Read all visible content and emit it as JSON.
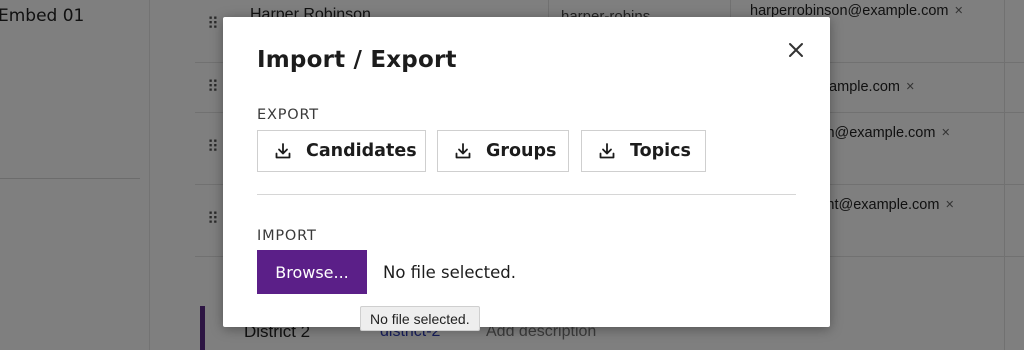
{
  "background": {
    "embed_label": "Embed 01",
    "row1_name": "Harper Robinson",
    "row1_slug": "harper-robins",
    "rows": [
      {
        "email": "harperrobinson@example.com",
        "remove": "×"
      },
      {
        "email": "t@example.com",
        "remove": "×"
      },
      {
        "email": "npson@example.com",
        "remove": "×"
      },
      {
        "email": "rwright@example.com",
        "remove": "×"
      }
    ],
    "district_name": "District 2",
    "district_slug": "district-2",
    "add_description": "Add description"
  },
  "modal": {
    "title": "Import / Export",
    "close_icon": "close-icon",
    "export_label": "EXPORT",
    "export_buttons": [
      {
        "label": "Candidates",
        "icon": "download-icon"
      },
      {
        "label": "Groups",
        "icon": "download-icon"
      },
      {
        "label": "Topics",
        "icon": "download-icon"
      }
    ],
    "import_label": "IMPORT",
    "browse_label": "Browse...",
    "file_status": "No file selected.",
    "tooltip": "No file selected."
  },
  "colors": {
    "accent": "#5b1f88",
    "overlay": "rgba(0,0,0,0.5)"
  }
}
